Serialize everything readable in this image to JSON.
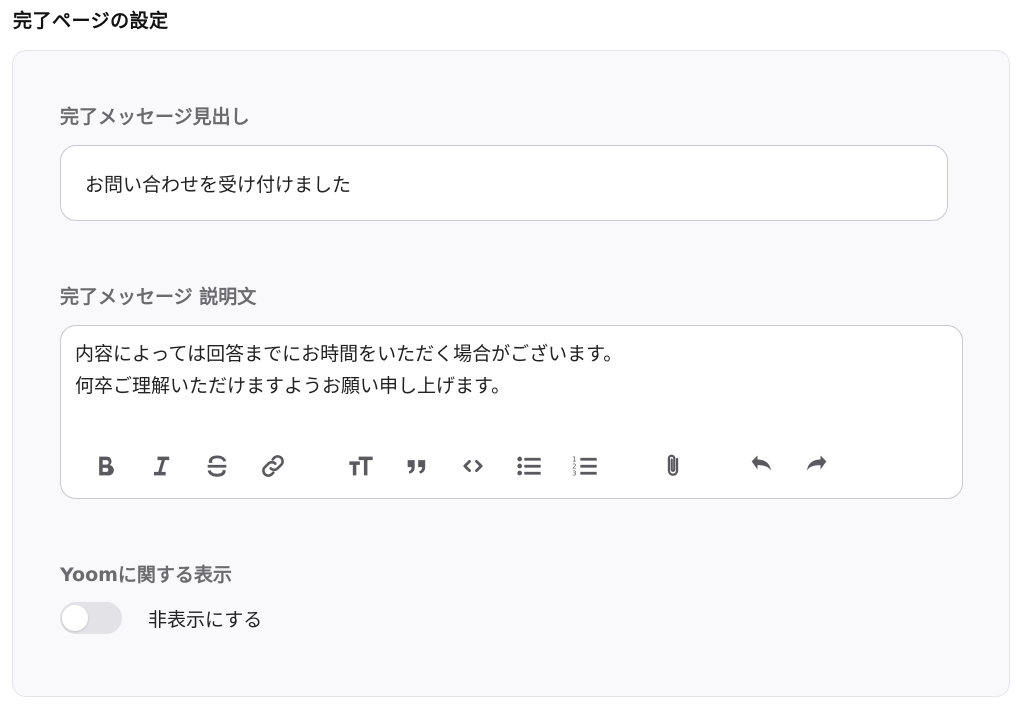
{
  "section": {
    "title": "完了ページの設定"
  },
  "heading_field": {
    "label": "完了メッセージ見出し",
    "value": "お問い合わせを受け付けました"
  },
  "description_field": {
    "label": "完了メッセージ 説明文",
    "lines": [
      "内容によっては回答までにお時間をいただく場合がございます。",
      "何卒ご理解いただけますようお願い申し上げます。"
    ],
    "toolbar": [
      "bold-icon",
      "italic-icon",
      "strikethrough-icon",
      "link-icon",
      "heading-icon",
      "quote-icon",
      "code-icon",
      "bullet-list-icon",
      "numbered-list-icon",
      "attach-icon",
      "undo-icon",
      "redo-icon"
    ]
  },
  "yoom_display": {
    "label": "Yoomに関する表示",
    "toggle_label": "非表示にする",
    "toggle_on": false
  },
  "colors": {
    "panel_bg": "#f9f8fb",
    "label_gray": "#6b6b6f",
    "toggle_off": "#e3e2e7"
  }
}
